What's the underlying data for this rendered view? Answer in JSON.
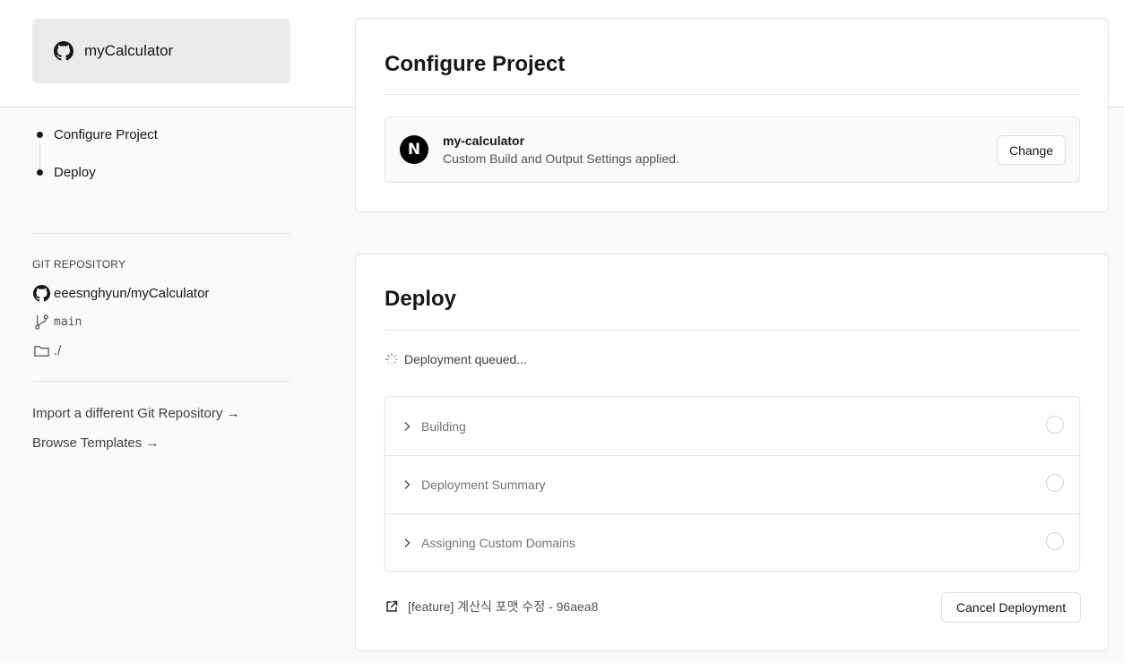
{
  "sidebar": {
    "repo_card_name": "myCalculator",
    "steps": [
      {
        "label": "Configure Project"
      },
      {
        "label": "Deploy"
      }
    ],
    "git": {
      "title": "GIT REPOSITORY",
      "repository": "eeesnghyun/myCalculator",
      "branch": "main",
      "root_directory": "./"
    },
    "links": [
      {
        "label": "Import a different Git Repository →"
      },
      {
        "label": "Browse Templates →"
      }
    ]
  },
  "configure": {
    "title": "Configure Project",
    "project_logo": "N",
    "project_name": "my-calculator",
    "project_subtitle": "Custom Build and Output Settings applied.",
    "change_label": "Change"
  },
  "deploy": {
    "title": "Deploy",
    "status": "Deployment queued...",
    "steps": [
      {
        "label": "Building"
      },
      {
        "label": "Deployment Summary"
      },
      {
        "label": "Assigning Custom Domains"
      }
    ],
    "commit_text": "[feature] 계산식 포맷 수정 - 96aea8",
    "cancel_label": "Cancel Deployment"
  },
  "colors": {
    "background": "#fafafa",
    "panel": "#ffffff",
    "border": "#e5e5e5",
    "text": "#171717",
    "muted": "#737373"
  },
  "icons": [
    "github-icon",
    "git-branch-icon",
    "folder-icon",
    "spinner-icon",
    "chevron-right-icon",
    "external-link-icon",
    "nextjs-logo-icon"
  ]
}
